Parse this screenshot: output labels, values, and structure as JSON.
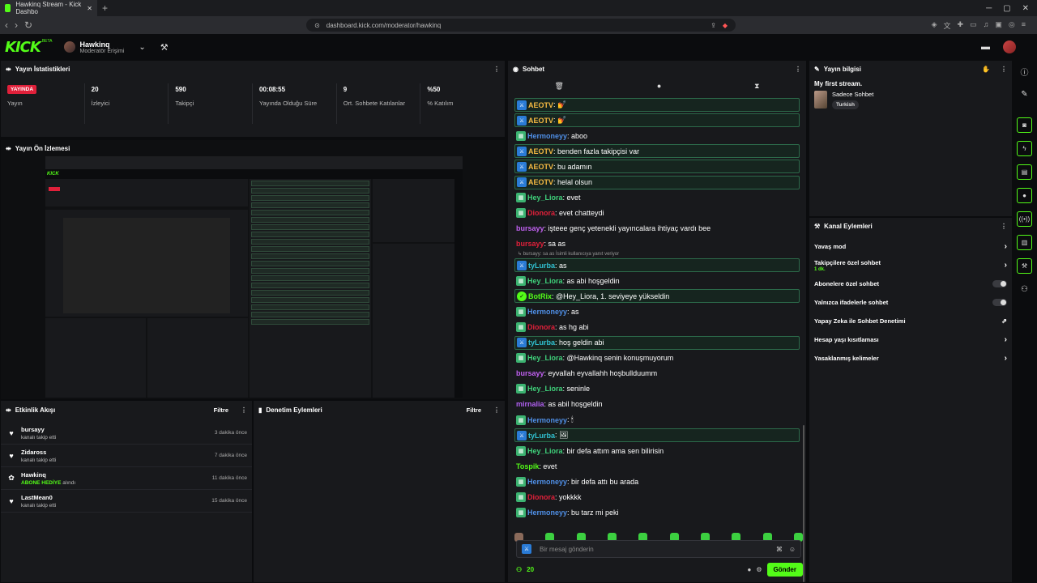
{
  "browser": {
    "tab_title": "Hawkinq Stream - Kick Dashbo",
    "new_tab": "+",
    "url": "dashboard.kick.com/moderator/hawkinq"
  },
  "topbar": {
    "logo": "KICK",
    "beta": "BETA",
    "channel_name": "Hawkinq",
    "channel_role": "Moderatör Erişimi"
  },
  "stats": {
    "title": "Yayın İstatistikleri",
    "live_badge": "YAYINDA",
    "items": [
      {
        "label": "Yayın",
        "value": ""
      },
      {
        "label": "İzleyici",
        "value": "20"
      },
      {
        "label": "Takipçi",
        "value": "590"
      },
      {
        "label": "Yayında Olduğu Süre",
        "value": "00:08:55"
      },
      {
        "label": "Ort. Sohbete Katılanlar",
        "value": "9"
      },
      {
        "label": "% Katılım",
        "value": "%50"
      }
    ]
  },
  "preview": {
    "title": "Yayın Ön İzlemesi"
  },
  "activity": {
    "title": "Etkinlik Akışı",
    "filter": "Filtre",
    "items": [
      {
        "name": "bursayy",
        "desc": "kanalı takip etti",
        "time": "3 dakika önce",
        "icon": "heart-icon"
      },
      {
        "name": "Zidaross",
        "desc": "kanalı takip etti",
        "time": "7 dakika önce",
        "icon": "heart-icon"
      },
      {
        "name": "Hawkinq",
        "desc": "ABONE HEDİYE",
        "desc2": "alındı",
        "time": "11 dakika önce",
        "icon": "gift-icon"
      },
      {
        "name": "LastMean0",
        "desc": "kanalı takip etti",
        "time": "15 dakika önce",
        "icon": "heart-icon"
      }
    ]
  },
  "moderation": {
    "title": "Denetim Eylemleri",
    "filter": "Filtre"
  },
  "chat": {
    "title": "Sohbet",
    "messages": [
      {
        "user": "AEOTV",
        "text": ": 💅",
        "color": "#f5b942",
        "badge": "mod",
        "hl": true
      },
      {
        "user": "AEOTV",
        "text": ": 💅",
        "color": "#f5b942",
        "badge": "mod",
        "hl": true
      },
      {
        "user": "Hermoneyy",
        "text": ": aboo",
        "color": "#4f8fe6",
        "badge": "sub",
        "hl": false
      },
      {
        "user": "AEOTV",
        "text": ": benden fazla takipçisi var",
        "color": "#f5b942",
        "badge": "mod",
        "hl": true
      },
      {
        "user": "AEOTV",
        "text": ": bu adamın",
        "color": "#f5b942",
        "badge": "mod",
        "hl": true
      },
      {
        "user": "AEOTV",
        "text": ": helal olsun",
        "color": "#f5b942",
        "badge": "mod",
        "hl": true
      },
      {
        "user": "Hey_Liora",
        "text": ": evet",
        "color": "#3fd07a",
        "badge": "sub",
        "hl": false
      },
      {
        "user": "Dionora",
        "text": ": evet chatteydi",
        "color": "#e0203a",
        "badge": "sub",
        "hl": false
      },
      {
        "user": "bursayy",
        "text": ": işteee genç yetenekli yayıncalara ihtiyaç vardı bee",
        "color": "#c060f0",
        "badge": "",
        "hl": false
      },
      {
        "user": "bursayy",
        "text": ": sa as",
        "color": "#e0203a",
        "badge": "",
        "hl": false
      },
      {
        "user": "tyLurba",
        "text": ": as",
        "color": "#30c0d0",
        "badge": "mod",
        "hl": true,
        "reply": "↳ bursayy: sa as İsimli kullanıcıya yanıt veriyor"
      },
      {
        "user": "Hey_Liora",
        "text": ": as abi hoşgeldin",
        "color": "#3fd07a",
        "badge": "sub",
        "hl": false
      },
      {
        "user": "BotRix",
        "text": ": @Hey_Liora, 1. seviyeye yükseldin",
        "color": "#53fc18",
        "badge": "bot",
        "hl": true
      },
      {
        "user": "Hermoneyy",
        "text": ": as",
        "color": "#4f8fe6",
        "badge": "sub",
        "hl": false
      },
      {
        "user": "Dionora",
        "text": ": as hg abi",
        "color": "#e0203a",
        "badge": "sub",
        "hl": false
      },
      {
        "user": "tyLurba",
        "text": ": hoş geldin abi",
        "color": "#30c0d0",
        "badge": "mod",
        "hl": true
      },
      {
        "user": "Hey_Liora",
        "text": ": @Hawkinq senin konuşmuyorum",
        "color": "#3fd07a",
        "badge": "sub",
        "hl": false
      },
      {
        "user": "bursayy",
        "text": ": eyvallah eyvallahh hoşbullduumm",
        "color": "#c060f0",
        "badge": "",
        "hl": false
      },
      {
        "user": "Hey_Liora",
        "text": ": seninle",
        "color": "#3fd07a",
        "badge": "sub",
        "hl": false
      },
      {
        "user": "mirnalia",
        "text": ": as abil hoşgeldin",
        "color": "#b060f0",
        "badge": "",
        "hl": false
      },
      {
        "user": "Hermoneyy",
        "text": ": 🕯",
        "color": "#4f8fe6",
        "badge": "sub",
        "hl": false
      },
      {
        "user": "tyLurba",
        "text": ": 🖼",
        "color": "#30c0d0",
        "badge": "mod",
        "hl": true
      },
      {
        "user": "Hey_Liora",
        "text": ": bir defa attım ama sen bilirisin",
        "color": "#3fd07a",
        "badge": "sub",
        "hl": false
      },
      {
        "user": "Tospik",
        "text": ": evet",
        "color": "#53fc18",
        "badge": "",
        "hl": false
      },
      {
        "user": "Hermoneyy",
        "text": ": bir defa attı bu arada",
        "color": "#4f8fe6",
        "badge": "sub",
        "hl": false
      },
      {
        "user": "Dionora",
        "text": ": yokkkk",
        "color": "#e0203a",
        "badge": "sub",
        "hl": false
      },
      {
        "user": "Hermoneyy",
        "text": ": bu tarz mi peki",
        "color": "#4f8fe6",
        "badge": "sub",
        "hl": false
      }
    ],
    "input_placeholder": "Bir mesaj gönderin",
    "viewer_count": "20",
    "send": "Gönder"
  },
  "info": {
    "title": "Yayın bilgisi",
    "stream_title": "My first stream.",
    "category": "Sadece Sohbet",
    "tag": "Turkish"
  },
  "actions": {
    "title": "Kanal Eylemleri",
    "items": [
      {
        "label": "Yavaş mod",
        "type": "arrow"
      },
      {
        "label": "Takipçilere özel sohbet",
        "sub": "1 dk.",
        "type": "arrow"
      },
      {
        "label": "Abonelere özel sohbet",
        "type": "toggle"
      },
      {
        "label": "Yalnızca ifadelerle sohbet",
        "type": "toggle"
      },
      {
        "label": "Yapay Zeka ile Sohbet Denetimi",
        "type": "external"
      },
      {
        "label": "Hesap yaşı kısıtlaması",
        "type": "arrow"
      },
      {
        "label": "Yasaklanmış kelimeler",
        "type": "arrow"
      }
    ]
  },
  "colors": {
    "accent": "#53fc18",
    "live": "#e0203a"
  }
}
